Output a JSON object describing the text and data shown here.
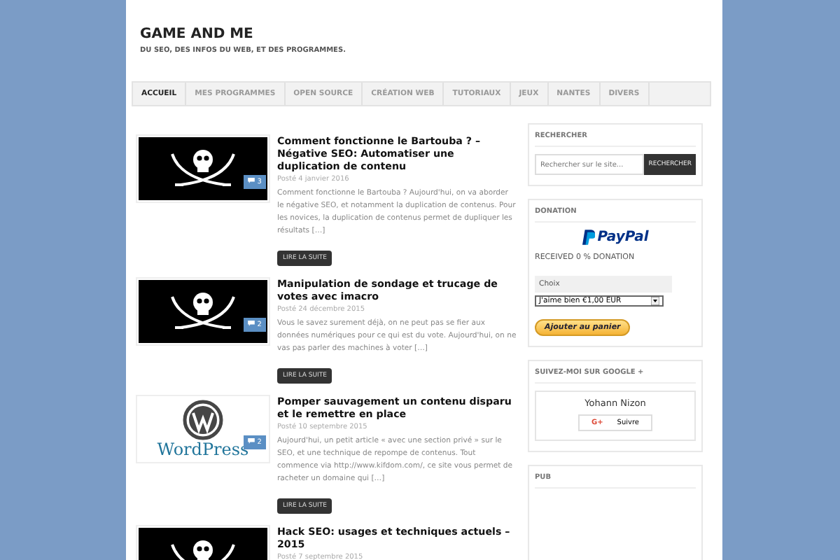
{
  "site": {
    "title": "GAME AND ME",
    "tagline": "DU SEO, DES INFOS DU WEB, ET DES PROGRAMMES."
  },
  "nav": [
    {
      "label": "ACCUEIL",
      "selected": true
    },
    {
      "label": "MES PROGRAMMES",
      "selected": false
    },
    {
      "label": "OPEN SOURCE",
      "selected": false
    },
    {
      "label": "CRÉATION WEB",
      "selected": false
    },
    {
      "label": "TUTORIAUX",
      "selected": false
    },
    {
      "label": "JEUX",
      "selected": false
    },
    {
      "label": "NANTES",
      "selected": false
    },
    {
      "label": "DIVERS",
      "selected": false
    }
  ],
  "posts": [
    {
      "thumb": {
        "kind": "pirate"
      },
      "comments": "3",
      "title": "Comment fonctionne le Bartouba ? – Négative SEO: Automatiser une duplication de contenu",
      "date": "Posté 4 janvier 2016",
      "excerpt": "Comment fonctionne le Bartouba ? Aujourd'hui, on va aborder le négative SEO, et notamment la duplication de contenus. Pour les novices, la duplication de contenus permet de dupliquer les résultats […]",
      "button": "LIRE LA SUITE"
    },
    {
      "thumb": {
        "kind": "pirate"
      },
      "comments": "2",
      "title": "Manipulation de sondage et trucage de votes avec imacro",
      "date": "Posté 24 décembre 2015",
      "excerpt": "Vous le savez surement déjà, on ne peut pas se fier aux données numériques pour ce qui est du vote. Aujourd'hui, on ne vas pas parler des machines à voter […]",
      "button": "LIRE LA SUITE"
    },
    {
      "thumb": {
        "kind": "wordpress",
        "label": "WordPress"
      },
      "comments": "2",
      "title": "Pomper sauvagement un contenu disparu et le remettre en place",
      "date": "Posté 10 septembre 2015",
      "excerpt": "Aujourd'hui, un petit article « avec une section privé » sur le SEO, et une technique de repompe de contenus. Tout commence via http://www.kifdom.com/, ce site vous permet de racheter un domaine qui […]",
      "button": "LIRE LA SUITE"
    },
    {
      "thumb": {
        "kind": "pirate"
      },
      "title": "Hack SEO: usages et techniques actuels – 2015",
      "date": "Posté 7 septembre 2015"
    }
  ],
  "sidebar": {
    "search": {
      "heading": "RECHERCHER",
      "placeholder": "Rechercher sur le site...",
      "button": "RECHERCHER"
    },
    "donation": {
      "heading": "DONATION",
      "logo": "PayPal",
      "received": "RECEIVED 0 % DONATION",
      "choice_label": "Choix",
      "choice_value": "J'aime bien €1,00 EUR",
      "button": "Ajouter au panier"
    },
    "google": {
      "heading": "SUIVEZ-MOI SUR GOOGLE +",
      "name": "Yohann Nizon",
      "badge": "G+",
      "button": "Suivre"
    },
    "pub": {
      "heading": "PUB"
    }
  }
}
